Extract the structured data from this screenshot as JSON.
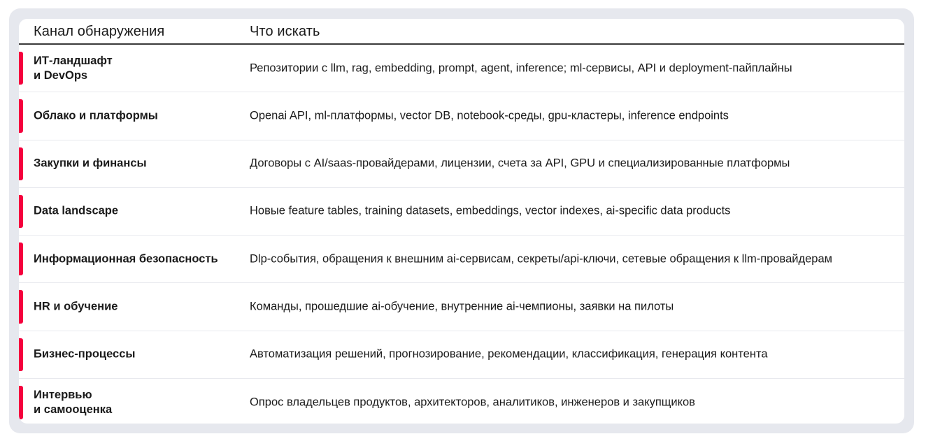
{
  "table": {
    "headers": {
      "channel": "Канал обнаружения",
      "what": "Что искать"
    },
    "rows": [
      {
        "channel": "ИТ-ландшафт\nи DevOps",
        "what": "Репозитории с llm, rag, embedding, prompt, agent, inference; ml-сервисы, API и deployment-пайплайны"
      },
      {
        "channel": "Облако и платформы",
        "what": "Openai API, ml-платформы, vector DB, notebook-среды, gpu-кластеры, inference endpoints"
      },
      {
        "channel": "Закупки и финансы",
        "what": "Договоры с AI/saas-провайдерами, лицензии,  счета за API, GPU и специализированные платформы"
      },
      {
        "channel": "Data landscape",
        "what": "Новые feature tables, training datasets, embeddings, vector indexes, ai-specific data products"
      },
      {
        "channel": "Информационная безопасность",
        "what": "Dlp-события, обращения к внешним ai-сервисам, секреты/api-ключи, сетевые обращения к llm-провайдерам"
      },
      {
        "channel": "HR и обучение",
        "what": "Команды, прошедшие ai-обучение,  внутренние ai-чемпионы, заявки на пилоты"
      },
      {
        "channel": "Бизнес-процессы",
        "what": "Автоматизация решений, прогнозирование, рекомендации, классификация, генерация контента"
      },
      {
        "channel": "Интервью\nи самооценка",
        "what": "Опрос владельцев продуктов, архитекторов, аналитиков, инженеров и закупщиков"
      }
    ]
  },
  "colors": {
    "accent": "#f5003d",
    "frame": "#e6e8ee",
    "text": "#1a1a1a"
  }
}
